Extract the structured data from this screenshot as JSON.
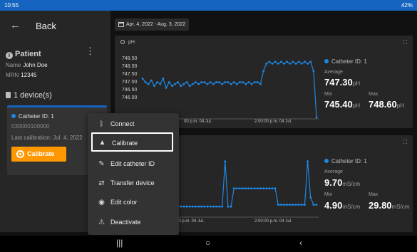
{
  "status_bar": {
    "time": "10:55",
    "battery": "42%"
  },
  "nav": {
    "back_label": "Back"
  },
  "patient": {
    "section_title": "Patient",
    "name_label": "Name",
    "name_value": "John Doe",
    "mrn_label": "MRN",
    "mrn_value": "12345"
  },
  "devices": {
    "title": "1 device(s)"
  },
  "device_card": {
    "name": "Catheter ID: 1",
    "serial": "030000100000",
    "last_calibration": "Last calibration: Jul. 4, 2022",
    "calibrate_label": "Calibrate"
  },
  "date_range": "Apr. 4, 2022 - Aug. 3, 2022",
  "ph_panel": {
    "title": "pH",
    "stats": {
      "catheter": "Catheter ID: 1",
      "average_label": "Average",
      "average_value": "747.30",
      "unit": "pH",
      "min_label": "Min",
      "min_value": "745.40",
      "max_label": "Max",
      "max_value": "748.60"
    }
  },
  "ec_panel": {
    "stats": {
      "catheter": "Catheter ID: 1",
      "average_label": "Average",
      "average_value": "9.70",
      "unit": "mS/cm",
      "min_label": "Min",
      "min_value": "4.90",
      "max_label": "Max",
      "max_value": "29.80"
    }
  },
  "context_menu": {
    "items": [
      {
        "label": "Connect",
        "icon": "bluetooth-icon"
      },
      {
        "label": "Calibrate",
        "icon": "flask-icon"
      },
      {
        "label": "Edit catheter ID",
        "icon": "pencil-icon"
      },
      {
        "label": "Transfer device",
        "icon": "transfer-icon"
      },
      {
        "label": "Edit color",
        "icon": "palette-icon"
      },
      {
        "label": "Deactivate",
        "icon": "warning-icon"
      }
    ]
  },
  "colors": {
    "accent": "#1565c0",
    "series": "#1e88e5",
    "calibrate": "#ff9800"
  },
  "chart_data": [
    {
      "type": "line",
      "title": "pH",
      "yticks": [
        "748.50",
        "748.00",
        "747.50",
        "747.00",
        "746.50",
        "746.00"
      ],
      "ylim": [
        745.4,
        748.7
      ],
      "xticks": [
        "00 p.m. 04 Jul.",
        "2:00:00 p.m. 04 Jul."
      ],
      "series": [
        {
          "name": "Catheter ID: 1",
          "values": [
            747.5,
            747.3,
            747.2,
            747.4,
            747.1,
            747.3,
            747.2,
            747.5,
            747.0,
            747.3,
            747.1,
            747.2,
            747.3,
            747.1,
            747.2,
            747.3,
            747.1,
            747.2,
            747.3,
            747.2,
            747.3,
            747.3,
            747.2,
            747.3,
            747.2,
            747.3,
            747.3,
            747.2,
            747.3,
            747.3,
            747.2,
            747.3,
            747.2,
            747.3,
            747.3,
            747.2,
            747.3,
            747.2,
            747.3,
            747.3,
            747.2,
            747.9,
            748.3,
            748.4,
            748.3,
            748.4,
            748.3,
            748.4,
            748.3,
            748.4,
            748.3,
            748.4,
            748.3,
            748.4,
            748.3,
            748.4,
            748.3,
            748.4,
            747.9,
            745.4
          ]
        }
      ]
    },
    {
      "type": "line",
      "title": "",
      "xticks": [
        "00 p.m. 04 Jul.",
        "2:00:00 p.m. 04 Jul."
      ],
      "ylim": [
        0,
        32
      ],
      "series": [
        {
          "name": "Catheter ID: 1",
          "values": [
            5,
            5,
            5,
            5,
            5,
            5,
            5,
            5,
            5,
            5,
            5,
            5,
            5,
            5,
            5,
            5,
            5,
            5,
            5,
            5,
            5,
            5,
            5,
            5,
            5,
            5,
            5,
            5,
            29.8,
            5,
            5,
            15,
            15,
            15,
            15,
            15,
            15,
            15,
            15,
            15,
            15,
            15,
            15,
            15,
            15,
            15,
            6,
            6,
            6,
            6,
            6,
            6,
            6,
            6,
            6,
            6,
            29.8,
            10,
            6,
            6
          ]
        }
      ]
    }
  ]
}
